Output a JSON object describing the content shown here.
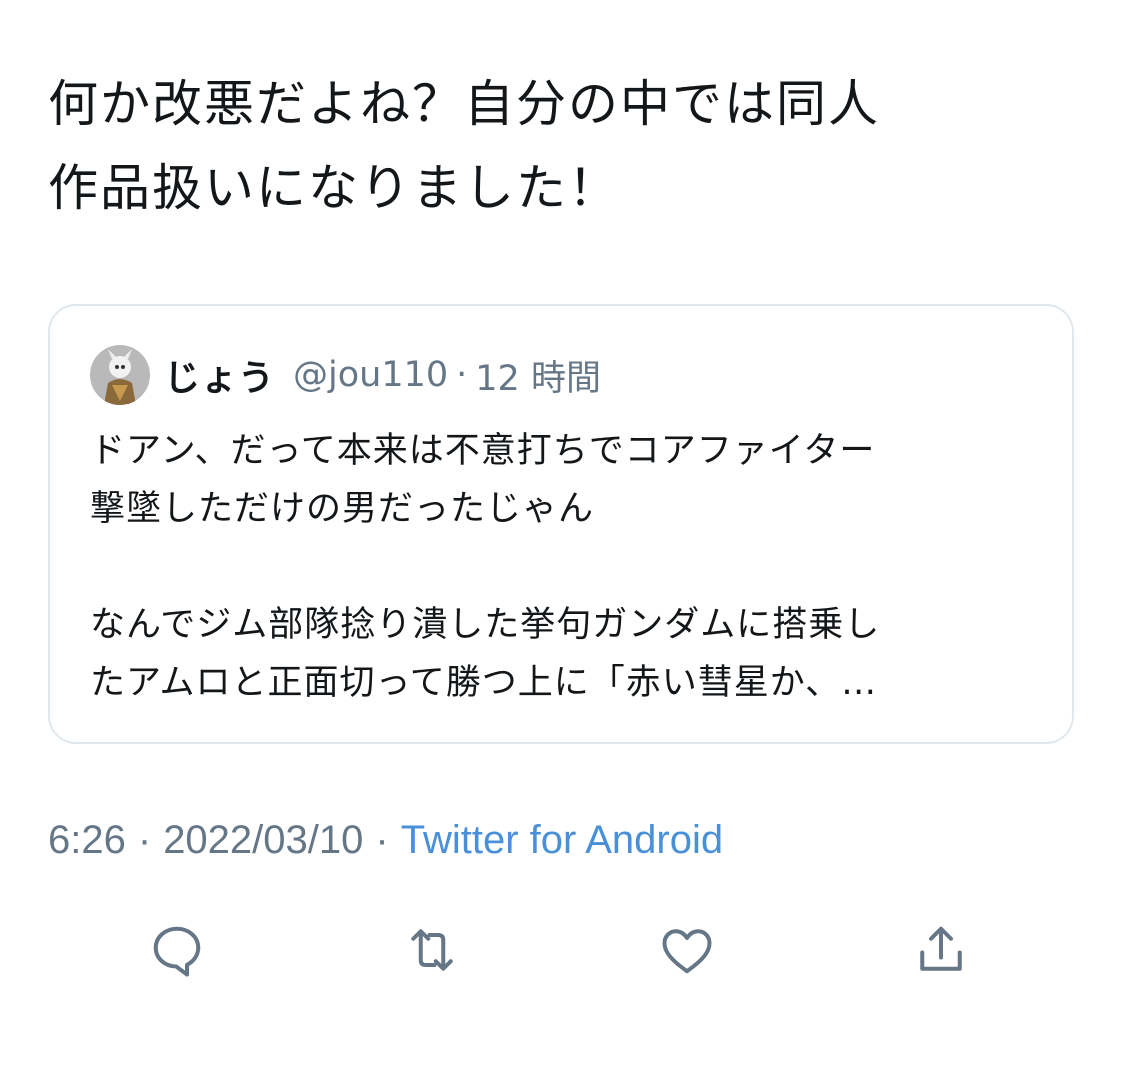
{
  "tweet": {
    "text": "何か改悪だよね？自分の中では同人\n作品扱いになりました！"
  },
  "quote": {
    "avatar_icon": "user-avatar",
    "display_name": "じょう",
    "handle": "@jou110",
    "separator": "·",
    "time_ago": "12 時間",
    "paragraph1": "ドアン、だって本来は不意打ちでコアファイター\n撃墜しただけの男だったじゃん",
    "paragraph2": "なんでジム部隊捻り潰した挙句ガンダムに搭乗し\nたアムロと正面切って勝つ上に「赤い彗星か、…"
  },
  "meta": {
    "time": "6:26",
    "separator": "·",
    "date": "2022/03/10",
    "source": "Twitter for Android"
  },
  "actions": {
    "reply_icon": "reply-icon",
    "retweet_icon": "retweet-icon",
    "like_icon": "like-icon",
    "share_icon": "share-icon"
  },
  "colors": {
    "text": "#14171a",
    "secondary": "#657786",
    "link": "#4a90d9",
    "border": "#e1e8ed"
  }
}
